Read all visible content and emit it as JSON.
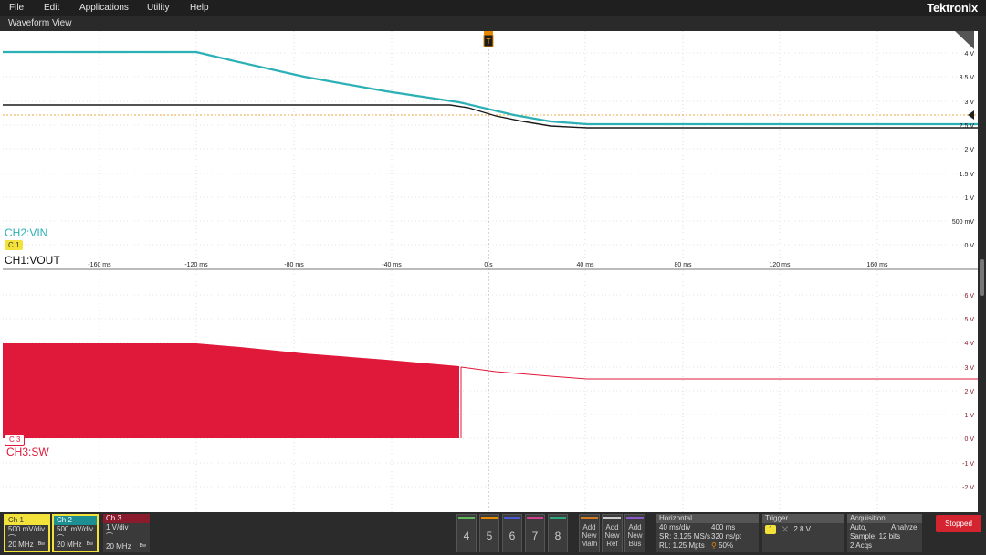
{
  "menu": {
    "items": [
      "File",
      "Edit",
      "Applications",
      "Utility",
      "Help"
    ],
    "brand": "Tektronix"
  },
  "waveform_view": {
    "title": "Waveform View",
    "trigger_marker": "T",
    "top_pane": {
      "y_labels": [
        "4 V",
        "3.5 V",
        "3 V",
        "2.5 V",
        "2 V",
        "1.5 V",
        "1 V",
        "500 mV",
        "0 V"
      ],
      "x_labels": [
        "-160 ms",
        "-120 ms",
        "-80 ms",
        "-40 ms",
        "0 s",
        "40 ms",
        "80 ms",
        "120 ms",
        "160 ms"
      ],
      "label_ch2": "CH2:VIN",
      "label_ch1": "CH1:VOUT",
      "badge_c1": "C 1"
    },
    "bottom_pane": {
      "y_labels": [
        "6 V",
        "5 V",
        "4 V",
        "3 V",
        "2 V",
        "1 V",
        "0 V",
        "-1 V",
        "-2 V"
      ],
      "label_ch3": "CH3:SW",
      "badge_c3": "C 3"
    },
    "colors": {
      "ch1": "#1a1a1a",
      "ch2": "#2bb0b5",
      "ch3": "#e0183a",
      "trigger": "#e58a00"
    }
  },
  "channels": [
    {
      "name": "Ch 1",
      "scale": "500 mV/div",
      "bw": "20 MHz"
    },
    {
      "name": "Ch 2",
      "scale": "500 mV/div",
      "bw": "20 MHz"
    },
    {
      "name": "Ch 3",
      "scale": "1 V/div",
      "bw": "20 MHz"
    }
  ],
  "extra_channels": [
    "4",
    "5",
    "6",
    "7",
    "8"
  ],
  "add_buttons": [
    {
      "line1": "Add",
      "line2": "New",
      "line3": "Math"
    },
    {
      "line1": "Add",
      "line2": "New",
      "line3": "Ref"
    },
    {
      "line1": "Add",
      "line2": "New",
      "line3": "Bus"
    }
  ],
  "horizontal": {
    "title": "Horizontal",
    "scale": "40 ms/div",
    "position": "400 ms",
    "sample_rate": "SR: 3.125 MS/s",
    "resolution": "320 ns/pt",
    "record_length": "RL: 1.25 Mpts",
    "position_pct": "50%"
  },
  "trigger": {
    "title": "Trigger",
    "source": "1",
    "level": "2.8 V"
  },
  "acquisition": {
    "title": "Acquisition",
    "mode": "Auto,",
    "analyze": "Analyze",
    "sample": "Sample: 12 bits",
    "acqs": "2 Acqs"
  },
  "status": "Stopped"
}
